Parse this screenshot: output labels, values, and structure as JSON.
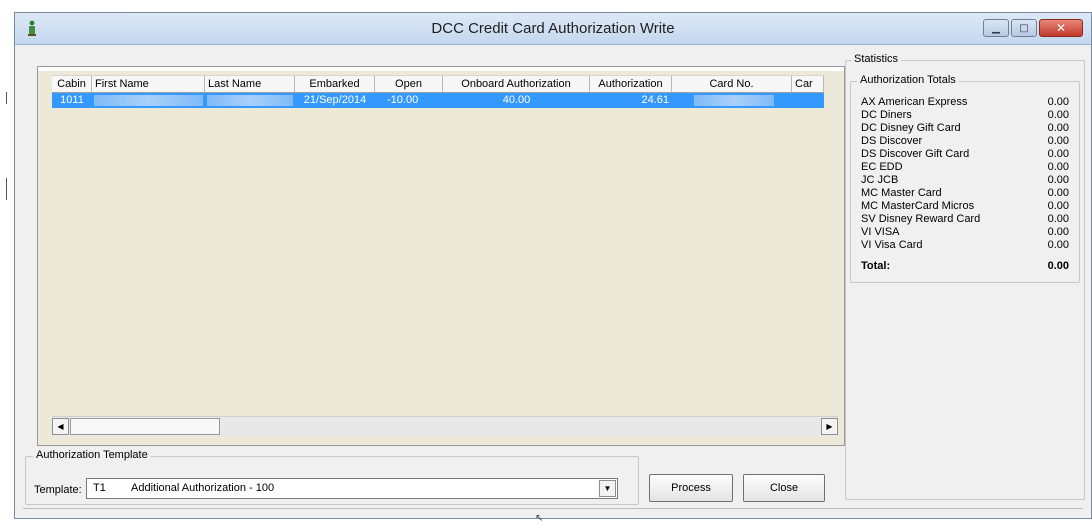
{
  "window": {
    "title": "DCC Credit Card Authorization Write"
  },
  "grid": {
    "columns": [
      "Cabin",
      "First Name",
      "Last Name",
      "Embarked",
      "Open",
      "Onboard Authorization",
      "Authorization",
      "Card No.",
      "Car"
    ],
    "rows": [
      {
        "cabin": "1011",
        "first_name": "",
        "last_name": "",
        "embarked": "21/Sep/2014",
        "open": "-10.00",
        "onboard_authorization": "40.00",
        "authorization": "24.61",
        "card_no": "",
        "card": ""
      }
    ]
  },
  "template_group": {
    "legend": "Authorization Template",
    "label": "Template:",
    "selected_code": "T1",
    "selected_desc": "Additional Authorization - 100"
  },
  "buttons": {
    "process": "Process",
    "close": "Close"
  },
  "statistics": {
    "legend": "Statistics",
    "totals_legend": "Authorization Totals",
    "items": [
      {
        "name": "AX  American Express",
        "value": "0.00"
      },
      {
        "name": "DC  Diners",
        "value": "0.00"
      },
      {
        "name": "DC  Disney Gift Card",
        "value": "0.00"
      },
      {
        "name": "DS  Discover",
        "value": "0.00"
      },
      {
        "name": "DS  Discover Gift Card",
        "value": "0.00"
      },
      {
        "name": "EC  EDD",
        "value": "0.00"
      },
      {
        "name": "JC  JCB",
        "value": "0.00"
      },
      {
        "name": "MC  Master Card",
        "value": "0.00"
      },
      {
        "name": "MC  MasterCard Micros",
        "value": "0.00"
      },
      {
        "name": "SV  Disney Reward Card",
        "value": "0.00"
      },
      {
        "name": "VI  VISA",
        "value": "0.00"
      },
      {
        "name": "VI  Visa Card",
        "value": "0.00"
      }
    ],
    "total_label": "Total:",
    "total_value": "0.00"
  },
  "colors": {
    "selection": "#3399ff",
    "grid_background": "#ece9d8",
    "titlebar": "#c4d7ee",
    "close_button": "#c1392b"
  },
  "icons": {
    "app": "info-person-icon",
    "minimize": "minimize-icon",
    "maximize": "maximize-icon",
    "close": "close-icon"
  }
}
